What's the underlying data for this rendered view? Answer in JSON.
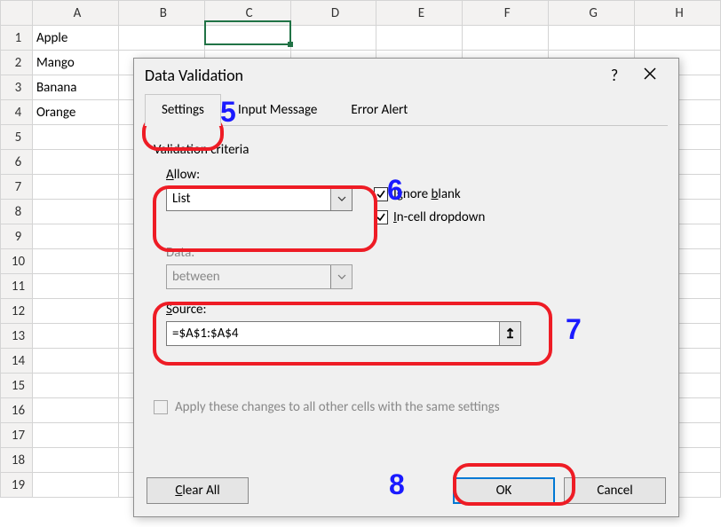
{
  "sheet": {
    "columns": [
      "A",
      "B",
      "C",
      "D",
      "E",
      "F",
      "G",
      "H"
    ],
    "rows": [
      "1",
      "2",
      "3",
      "4",
      "5",
      "6",
      "7",
      "8",
      "9",
      "10",
      "11",
      "12",
      "13",
      "14",
      "15",
      "16",
      "17",
      "18",
      "19"
    ],
    "data": {
      "A1": "Apple",
      "A2": "Mango",
      "A3": "Banana",
      "A4": "Orange"
    },
    "selected_cell": "C1"
  },
  "dialog": {
    "title": "Data Validation",
    "help_glyph": "?",
    "tabs": {
      "settings": "Settings",
      "input_message": "Input Message",
      "error_alert": "Error Alert"
    },
    "criteria_header": "Validation criteria",
    "allow_label_pre": "A",
    "allow_label_rest": "llow:",
    "allow_value": "List",
    "data_label": "Data:",
    "data_value": "between",
    "source_label_pre": "S",
    "source_label_rest": "ource:",
    "source_value": "=$A$1:$A$4",
    "ignore_blank_pre": "Ignore ",
    "ignore_blank_ul": "b",
    "ignore_blank_post": "lank",
    "incell_dd_pre": "I",
    "incell_dd_rest": "n-cell dropdown",
    "apply_text": "Apply these changes to all other cells with the same settings",
    "clear_all_ul": "C",
    "clear_all_rest": "lear All",
    "ok_label": "OK",
    "cancel_label": "Cancel",
    "range_glyph": "↥"
  },
  "annotations": {
    "n5": "5",
    "n6": "6",
    "n7": "7",
    "n8": "8"
  }
}
